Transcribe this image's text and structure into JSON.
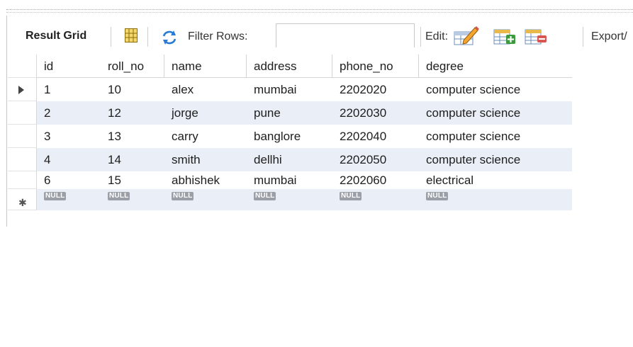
{
  "toolbar": {
    "result_grid_label": "Result Grid",
    "filter_label": "Filter Rows:",
    "filter_value": "",
    "edit_label": "Edit:",
    "export_label": "Export/"
  },
  "grid": {
    "columns": [
      "id",
      "roll_no",
      "name",
      "address",
      "phone_no",
      "degree"
    ],
    "rows": [
      [
        "1",
        "10",
        "alex",
        "mumbai",
        "2202020",
        "computer science"
      ],
      [
        "2",
        "12",
        "jorge",
        "pune",
        "2202030",
        "computer science"
      ],
      [
        "3",
        "13",
        "carry",
        "banglore",
        "2202040",
        "computer science"
      ],
      [
        "4",
        "14",
        "smith",
        "dellhi",
        "2202050",
        "computer science"
      ],
      [
        "6",
        "15",
        "abhishek",
        "mumbai",
        "2202060",
        "electrical"
      ]
    ],
    "null_label": "NULL"
  },
  "icons": {
    "grid": "grid-icon",
    "refresh": "refresh-icon",
    "edit": "edit-icon",
    "add_row": "add-row-icon",
    "delete_row": "delete-row-icon",
    "current_row": "current-row-arrow-icon",
    "new_row": "new-row-star-icon"
  }
}
